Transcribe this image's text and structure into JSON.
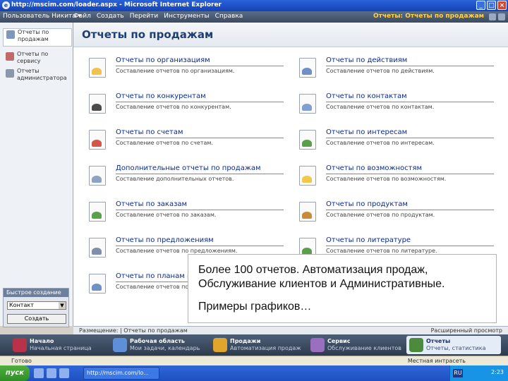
{
  "window": {
    "title": "http://mscim.com/loader.aspx - Microsoft Internet Explorer"
  },
  "nav": {
    "workspace": "Пользователь Никита ▾",
    "menu": [
      "Файл",
      "Создать",
      "Перейти",
      "Инструменты",
      "Справка"
    ],
    "breadcrumb": "Отчеты: Отчеты по продажам"
  },
  "sidebar": {
    "items": [
      {
        "label": "Отчеты по продажам"
      },
      {
        "label": "Отчеты по сервису"
      },
      {
        "label": "Отчеты администратора"
      }
    ],
    "quick_create": {
      "title": "Быстрое создание",
      "select_value": "Контакт",
      "button": "Создать"
    }
  },
  "main": {
    "title": "Отчеты по продажам"
  },
  "reports": [
    {
      "title": "Отчеты по организациям",
      "desc": "Составление отчетов по организациям.",
      "color": "#f2c14e"
    },
    {
      "title": "Отчеты по действиям",
      "desc": "Составление отчетов по действиям.",
      "color": "#6f8fc7"
    },
    {
      "title": "Отчеты по конкурентам",
      "desc": "Составление отчетов по конкурентам.",
      "color": "#4a4a4a"
    },
    {
      "title": "Отчеты по контактам",
      "desc": "Составление отчетов по контактам.",
      "color": "#7fa0d0"
    },
    {
      "title": "Отчеты по счетам",
      "desc": "Составление отчетов по счетам.",
      "color": "#d0574a"
    },
    {
      "title": "Отчеты по интересам",
      "desc": "Составление отчетов по интересам.",
      "color": "#5aa04a"
    },
    {
      "title": "Дополнительные отчеты по продажам",
      "desc": "Составление дополнительных отчетов.",
      "color": "#8ea3c2"
    },
    {
      "title": "Отчеты по возможностям",
      "desc": "Составление отчетов по возможностям.",
      "color": "#f0c94a"
    },
    {
      "title": "Отчеты по заказам",
      "desc": "Составление отчетов по заказам.",
      "color": "#5aa04a"
    },
    {
      "title": "Отчеты по продуктам",
      "desc": "Составление отчетов по продуктам.",
      "color": "#c98a3a"
    },
    {
      "title": "Отчеты по предложениям",
      "desc": "Составление отчетов по предложениям.",
      "color": "#7f8fa8"
    },
    {
      "title": "Отчеты по литературе",
      "desc": "Составление отчетов по литературе.",
      "color": "#5aa04a"
    },
    {
      "title": "Отчеты по планам продаж",
      "desc": "Составление отчетов по планам продаж.",
      "color": "#6f8fc7"
    }
  ],
  "bottom": {
    "left": "Размещение: | Отчеты по продажам",
    "right": "Расширенный просмотр"
  },
  "modules": [
    {
      "name": "Начало",
      "sub": "Начальная страница",
      "color": "#b8334a"
    },
    {
      "name": "Рабочая область",
      "sub": "Мои задачи, календарь",
      "color": "#5f8fd9"
    },
    {
      "name": "Продажи",
      "sub": "Автоматизация продаж",
      "color": "#e0a52b"
    },
    {
      "name": "Сервис",
      "sub": "Обслуживание клиентов",
      "color": "#9a6fc0"
    },
    {
      "name": "Отчеты",
      "sub": "Отчеты, статистика",
      "color": "#4c8a3e"
    }
  ],
  "status": {
    "left": "Готово",
    "right": "Местная интрасеть"
  },
  "taskbar": {
    "start": "пуск",
    "button": "http://mscim.com/lo...",
    "lang": "RU",
    "clock": "2:23"
  },
  "callout": {
    "line1": "Более 100 отчетов. Автоматизация продаж, Обслуживание клиентов и Административные.",
    "line2": "Примеры графиков…"
  }
}
